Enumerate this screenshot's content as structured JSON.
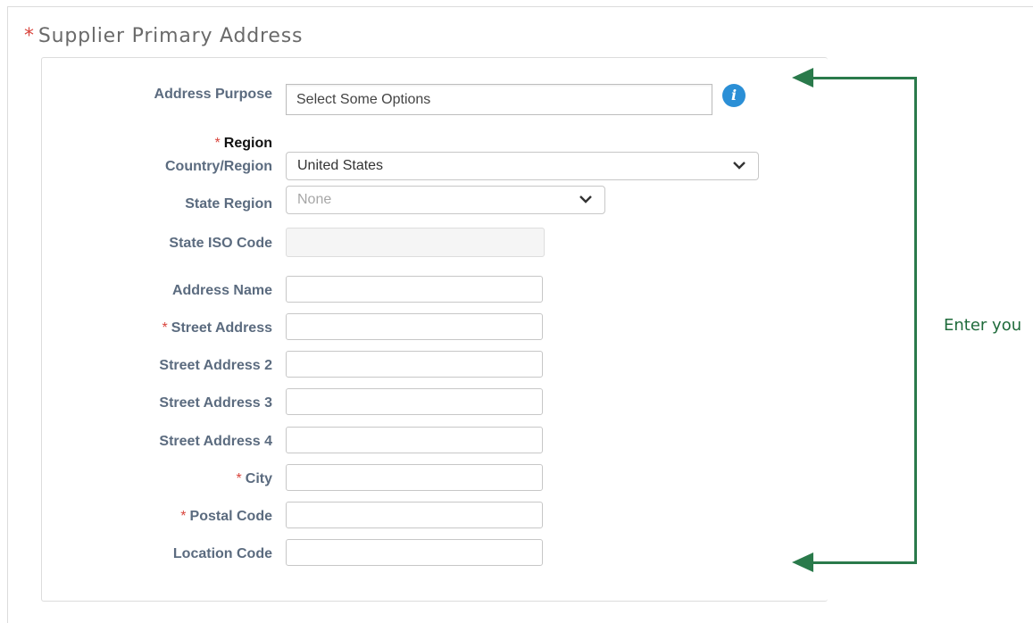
{
  "section": {
    "required_mark": "*",
    "title": "Supplier Primary Address"
  },
  "fields": {
    "address_purpose": {
      "label": "Address Purpose",
      "placeholder": "Select Some Options"
    },
    "region_heading": {
      "required_mark": "*",
      "label": "Region"
    },
    "country_region": {
      "label": "Country/Region",
      "value": "United States"
    },
    "state_region": {
      "label": "State Region",
      "value": "None"
    },
    "state_iso_code": {
      "label": "State ISO Code",
      "value": ""
    },
    "address_name": {
      "label": "Address Name",
      "value": ""
    },
    "street_address": {
      "required_mark": "*",
      "label": "Street Address",
      "value": ""
    },
    "street_address_2": {
      "label": "Street Address 2",
      "value": ""
    },
    "street_address_3": {
      "label": "Street Address 3",
      "value": ""
    },
    "street_address_4": {
      "label": "Street Address 4",
      "value": ""
    },
    "city": {
      "required_mark": "*",
      "label": "City",
      "value": ""
    },
    "postal_code": {
      "required_mark": "*",
      "label": "Postal Code",
      "value": ""
    },
    "location_code": {
      "label": "Location Code",
      "value": ""
    }
  },
  "annotation": {
    "text": "Enter you"
  },
  "icons": {
    "info": "info-icon",
    "dropdown": "chevron-down-icon",
    "arrow": "arrow-left-icon"
  },
  "colors": {
    "required": "#d9453d",
    "label": "#5b6b7f",
    "info": "#2b8fd6",
    "annotation": "#2a7a4b"
  }
}
